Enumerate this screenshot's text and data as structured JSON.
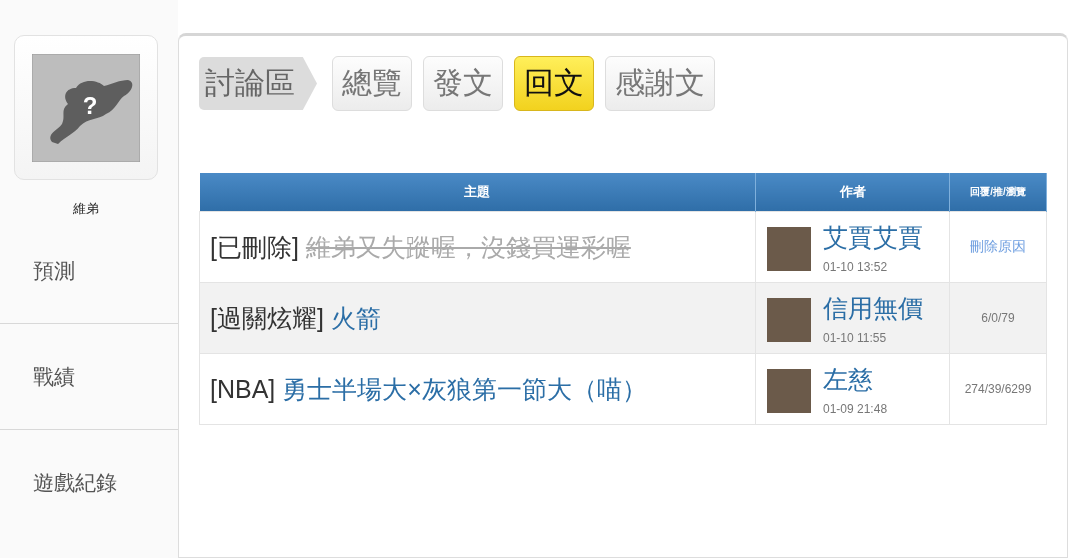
{
  "profile": {
    "avatar_glyph": "?",
    "name": "維弟"
  },
  "sidebar": {
    "items": [
      {
        "label": "預測"
      },
      {
        "label": "戰績"
      },
      {
        "label": "遊戲紀錄"
      }
    ]
  },
  "breadcrumb": "討論區",
  "tabs": [
    {
      "label": "總覽",
      "selected": false
    },
    {
      "label": "發文",
      "selected": false
    },
    {
      "label": "回文",
      "selected": true
    },
    {
      "label": "感謝文",
      "selected": false
    }
  ],
  "table": {
    "columns": [
      "主題",
      "作者",
      "回覆/推/瀏覽"
    ],
    "rows": [
      {
        "category": "[已刪除]",
        "title": "維弟又失蹤喔，沒錢買運彩喔",
        "deleted": true,
        "author": "艾賈艾賈",
        "time": "01-10 13:52",
        "stats": "刪除原因"
      },
      {
        "category": "[過關炫耀]",
        "title": "火箭",
        "deleted": false,
        "author": "信用無價",
        "time": "01-10 11:55",
        "stats": "6/0/79"
      },
      {
        "category": "[NBA]",
        "title": "勇士半場大×灰狼第一節大（喵）",
        "deleted": false,
        "author": "左慈",
        "time": "01-09 21:48",
        "stats": "274/39/6299"
      }
    ]
  }
}
